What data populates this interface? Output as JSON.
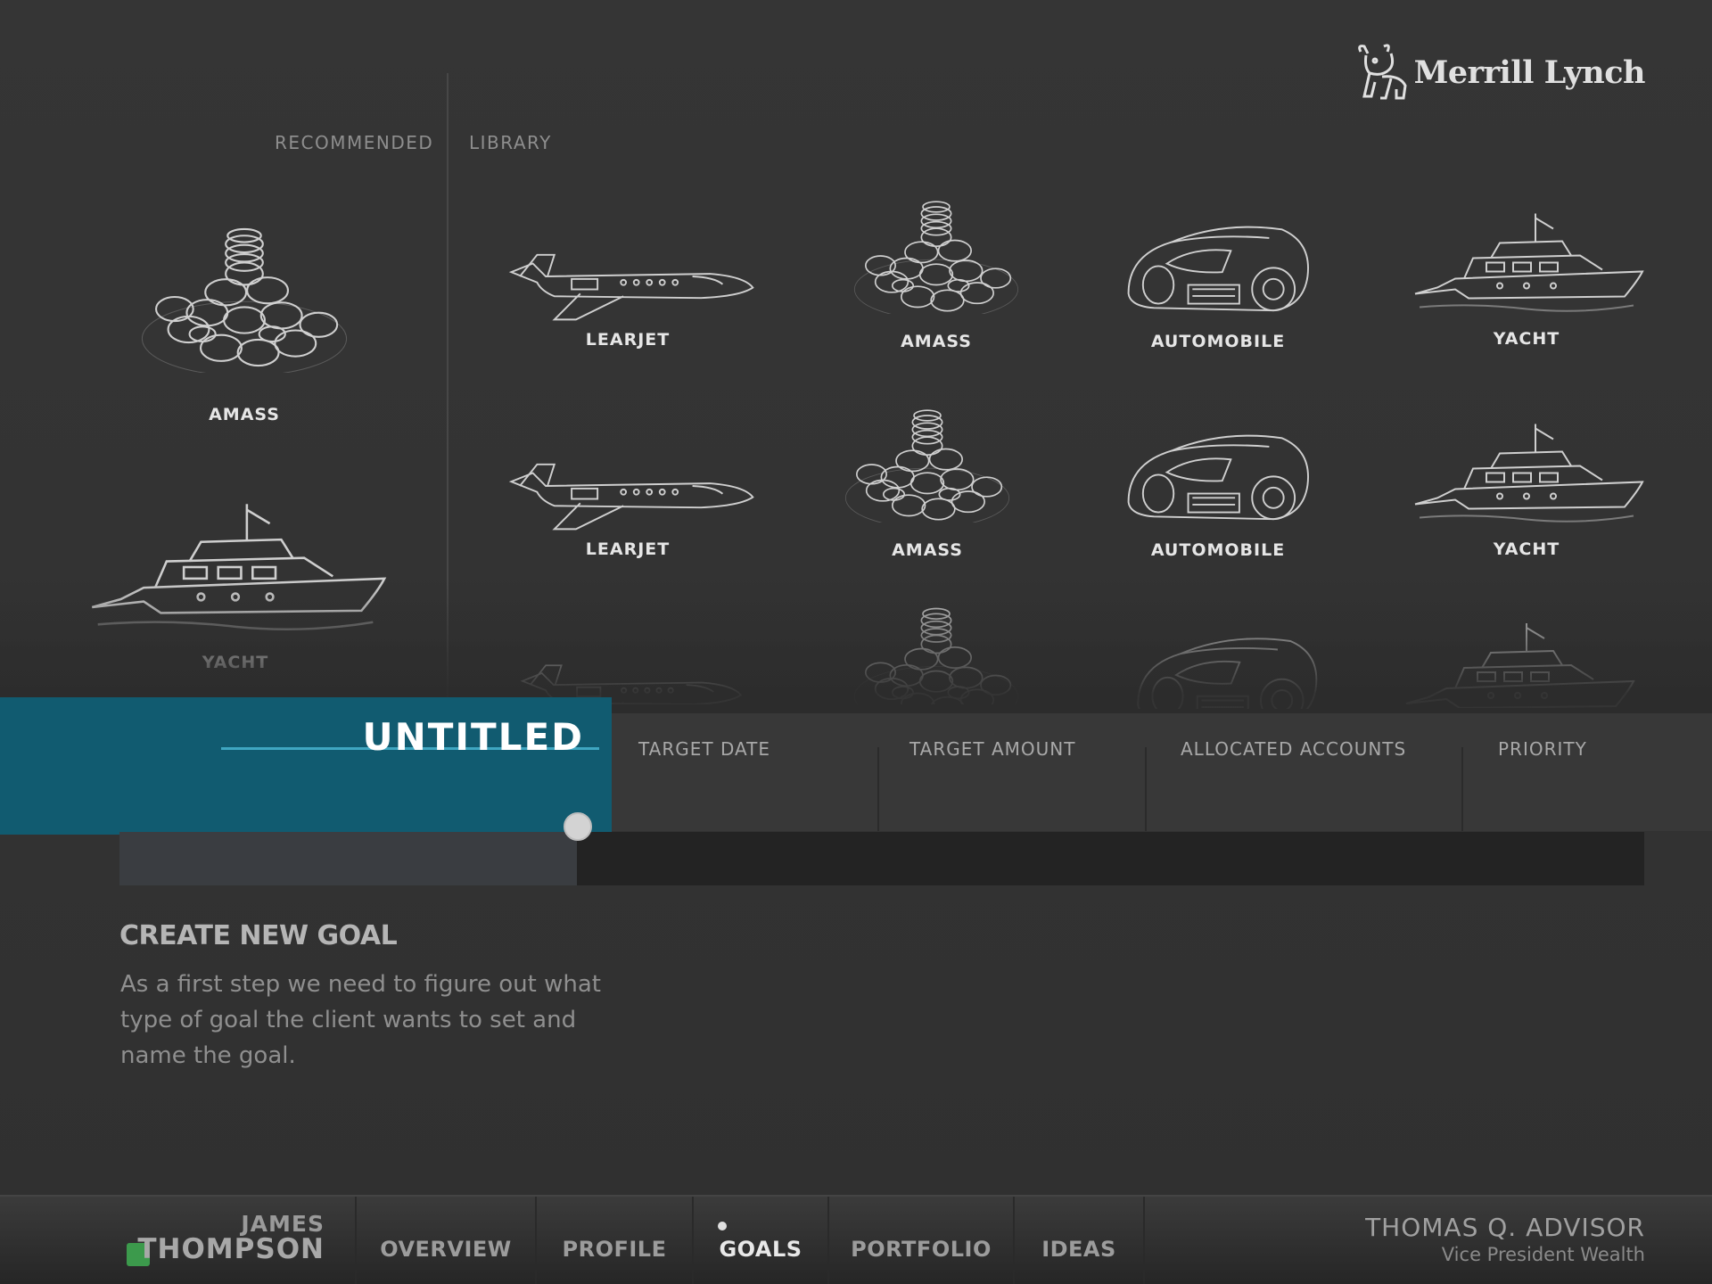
{
  "brand": {
    "name": "Merrill Lynch"
  },
  "sections": {
    "recommended": "RECOMMENDED",
    "library": "LIBRARY"
  },
  "recommended": [
    {
      "label": "AMASS",
      "icon": "coins-icon"
    },
    {
      "label": "YACHT",
      "icon": "yacht-icon"
    }
  ],
  "library": {
    "rows": [
      [
        {
          "label": "LEARJET",
          "icon": "jet-icon"
        },
        {
          "label": "AMASS",
          "icon": "coins-icon"
        },
        {
          "label": "AUTOMOBILE",
          "icon": "car-icon"
        },
        {
          "label": "YACHT",
          "icon": "yacht-icon"
        }
      ],
      [
        {
          "label": "LEARJET",
          "icon": "jet-icon"
        },
        {
          "label": "AMASS",
          "icon": "coins-icon"
        },
        {
          "label": "AUTOMOBILE",
          "icon": "car-icon"
        },
        {
          "label": "YACHT",
          "icon": "yacht-icon"
        }
      ]
    ]
  },
  "goal": {
    "title": "UNTITLED",
    "columns": [
      "TARGET DATE",
      "TARGET AMOUNT",
      "ALLOCATED ACCOUNTS",
      "PRIORITY"
    ],
    "progress_percent": 30,
    "accent_color": "#115b70"
  },
  "create": {
    "title": "CREATE NEW GOAL",
    "description": "As a first step we need to figure out what type of goal the client wants to set and name the goal."
  },
  "client": {
    "first_name": "JAMES",
    "last_name": "THOMPSON",
    "status_color": "#3c9a4c"
  },
  "nav": {
    "tabs": [
      "OVERVIEW",
      "PROFILE",
      "GOALS",
      "PORTFOLIO",
      "IDEAS"
    ],
    "active": "GOALS"
  },
  "advisor": {
    "name": "THOMAS Q. ADVISOR",
    "title": "Vice President Wealth"
  }
}
